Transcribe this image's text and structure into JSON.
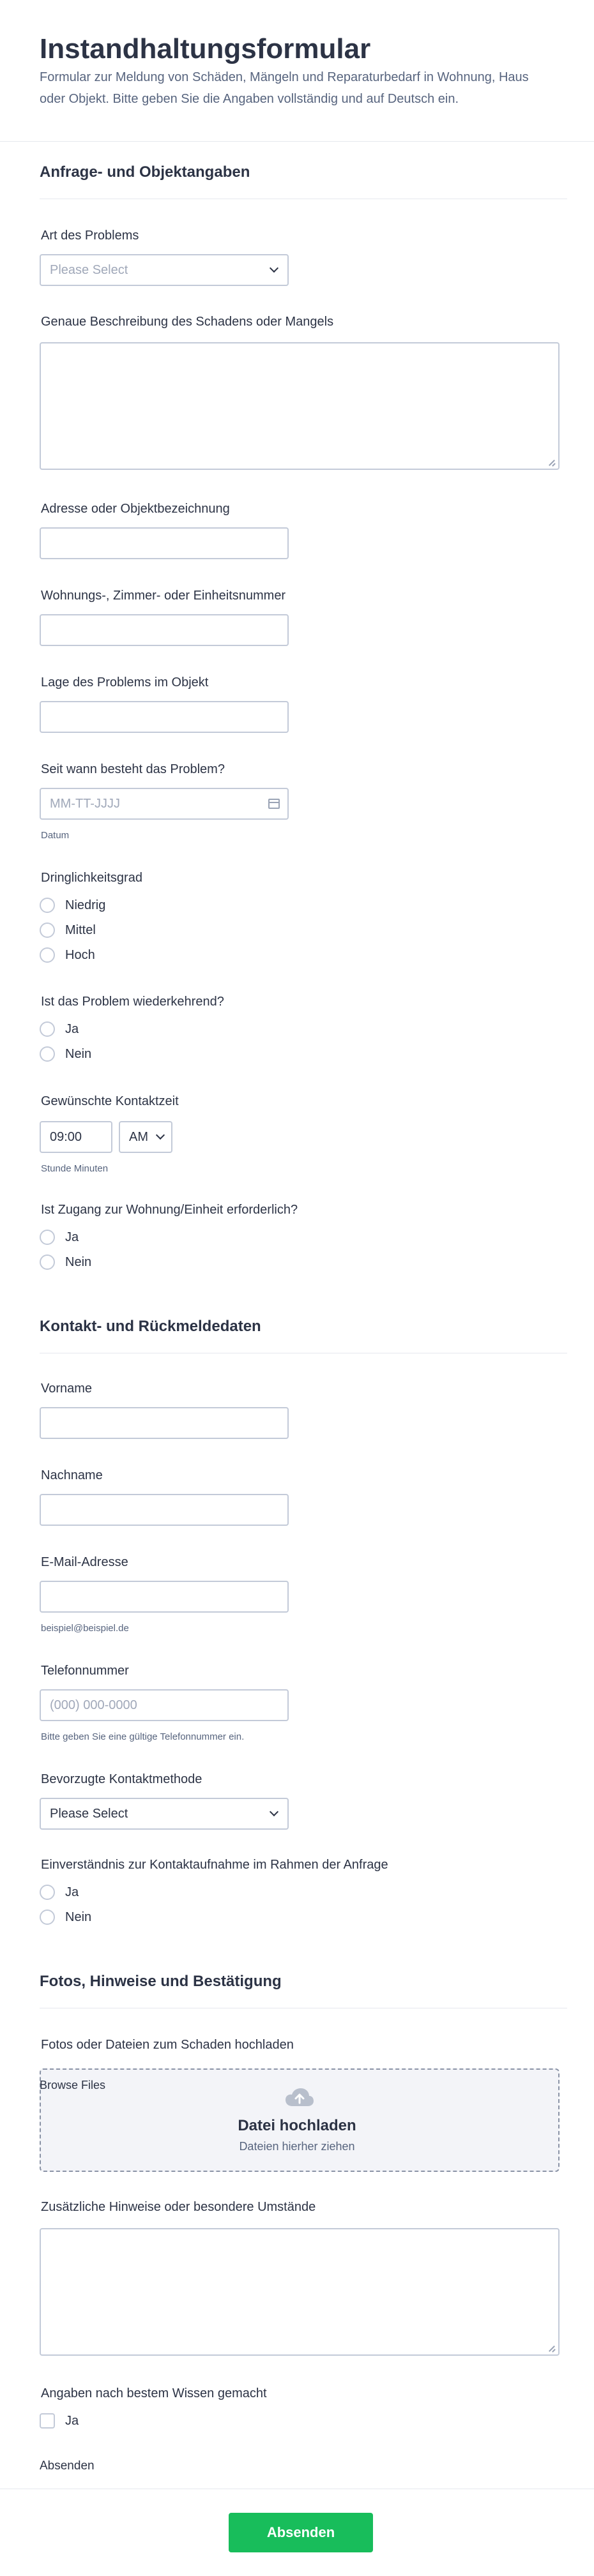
{
  "header": {
    "title": "Instandhaltungsformular",
    "description": "Formular zur Meldung von Schäden, Mängeln und Reparaturbedarf in Wohnung, Haus oder Objekt. Bitte geben Sie die Angaben vollständig und auf Deutsch ein."
  },
  "sections": {
    "s1": "Anfrage- und Objektangaben",
    "s2": "Kontakt- und Rückmeldedaten",
    "s3": "Fotos, Hinweise und Bestätigung"
  },
  "fields": {
    "problem_type": {
      "label": "Art des Problems",
      "value": "Please Select"
    },
    "description": {
      "label": "Genaue Beschreibung des Schadens oder Mangels"
    },
    "address": {
      "label": "Adresse oder Objektbezeichnung"
    },
    "unit": {
      "label": "Wohnungs-, Zimmer- oder Einheitsnummer"
    },
    "location": {
      "label": "Lage des Problems im Objekt"
    },
    "since": {
      "label": "Seit wann besteht das Problem?",
      "placeholder": "MM-TT-JJJJ",
      "sublabel": "Datum"
    },
    "urgency": {
      "label": "Dringlichkeitsgrad",
      "options": [
        "Niedrig",
        "Mittel",
        "Hoch"
      ]
    },
    "recurring": {
      "label": "Ist das Problem wiederkehrend?",
      "options": [
        "Ja",
        "Nein"
      ]
    },
    "contact_time": {
      "label": "Gewünschte Kontaktzeit",
      "time": "09:00",
      "ampm": "AM",
      "sublabel": "Stunde Minuten"
    },
    "access": {
      "label": "Ist Zugang zur Wohnung/Einheit erforderlich?",
      "options": [
        "Ja",
        "Nein"
      ]
    },
    "firstname": {
      "label": "Vorname"
    },
    "lastname": {
      "label": "Nachname"
    },
    "email": {
      "label": "E-Mail-Adresse",
      "sublabel": "beispiel@beispiel.de"
    },
    "phone": {
      "label": "Telefonnummer",
      "placeholder": "(000) 000-0000",
      "sublabel": "Bitte geben Sie eine gültige Telefonnummer ein."
    },
    "contact_method": {
      "label": "Bevorzugte Kontaktmethode",
      "value": "Please Select"
    },
    "consent": {
      "label": "Einverständnis zur Kontaktaufnahme im Rahmen der Anfrage",
      "options": [
        "Ja",
        "Nein"
      ]
    },
    "upload": {
      "label": "Fotos oder Dateien zum Schaden hochladen",
      "browse": "Browse Files",
      "title": "Datei hochladen",
      "sub": "Dateien hierher ziehen"
    },
    "notes": {
      "label": "Zusätzliche Hinweise oder besondere Umstände"
    },
    "confirm": {
      "label": "Angaben nach bestem Wissen gemacht",
      "option": "Ja"
    }
  },
  "submit": {
    "label": "Absenden",
    "button": "Absenden"
  },
  "colors": {
    "accent": "#18bd5b",
    "text": "#2c3345",
    "muted": "#57647e",
    "border": "#c3cad8"
  }
}
